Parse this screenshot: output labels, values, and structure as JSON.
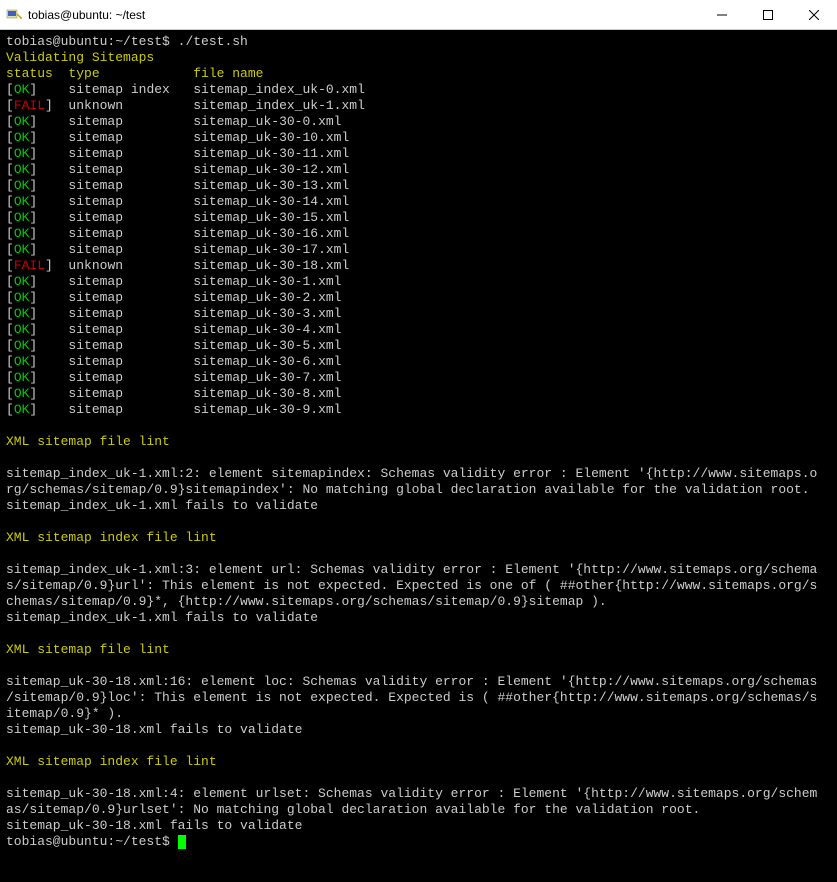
{
  "window": {
    "title": "tobias@ubuntu: ~/test"
  },
  "terminal": {
    "prompt": "tobias@ubuntu:~/test$ ",
    "command": "./test.sh",
    "heading_validating": "Validating Sitemaps",
    "header": {
      "status": "status",
      "type": "type",
      "filename": "file name"
    },
    "rows": [
      {
        "bracket_open": "[",
        "status": "OK",
        "bracket_close": "]",
        "status_class": "green",
        "type": "sitemap index",
        "file": "sitemap_index_uk-0.xml"
      },
      {
        "bracket_open": "[",
        "status": "FAIL",
        "bracket_close": "]",
        "status_class": "red",
        "type": "unknown",
        "file": "sitemap_index_uk-1.xml"
      },
      {
        "bracket_open": "[",
        "status": "OK",
        "bracket_close": "]",
        "status_class": "green",
        "type": "sitemap",
        "file": "sitemap_uk-30-0.xml"
      },
      {
        "bracket_open": "[",
        "status": "OK",
        "bracket_close": "]",
        "status_class": "green",
        "type": "sitemap",
        "file": "sitemap_uk-30-10.xml"
      },
      {
        "bracket_open": "[",
        "status": "OK",
        "bracket_close": "]",
        "status_class": "green",
        "type": "sitemap",
        "file": "sitemap_uk-30-11.xml"
      },
      {
        "bracket_open": "[",
        "status": "OK",
        "bracket_close": "]",
        "status_class": "green",
        "type": "sitemap",
        "file": "sitemap_uk-30-12.xml"
      },
      {
        "bracket_open": "[",
        "status": "OK",
        "bracket_close": "]",
        "status_class": "green",
        "type": "sitemap",
        "file": "sitemap_uk-30-13.xml"
      },
      {
        "bracket_open": "[",
        "status": "OK",
        "bracket_close": "]",
        "status_class": "green",
        "type": "sitemap",
        "file": "sitemap_uk-30-14.xml"
      },
      {
        "bracket_open": "[",
        "status": "OK",
        "bracket_close": "]",
        "status_class": "green",
        "type": "sitemap",
        "file": "sitemap_uk-30-15.xml"
      },
      {
        "bracket_open": "[",
        "status": "OK",
        "bracket_close": "]",
        "status_class": "green",
        "type": "sitemap",
        "file": "sitemap_uk-30-16.xml"
      },
      {
        "bracket_open": "[",
        "status": "OK",
        "bracket_close": "]",
        "status_class": "green",
        "type": "sitemap",
        "file": "sitemap_uk-30-17.xml"
      },
      {
        "bracket_open": "[",
        "status": "FAIL",
        "bracket_close": "]",
        "status_class": "red",
        "type": "unknown",
        "file": "sitemap_uk-30-18.xml"
      },
      {
        "bracket_open": "[",
        "status": "OK",
        "bracket_close": "]",
        "status_class": "green",
        "type": "sitemap",
        "file": "sitemap_uk-30-1.xml"
      },
      {
        "bracket_open": "[",
        "status": "OK",
        "bracket_close": "]",
        "status_class": "green",
        "type": "sitemap",
        "file": "sitemap_uk-30-2.xml"
      },
      {
        "bracket_open": "[",
        "status": "OK",
        "bracket_close": "]",
        "status_class": "green",
        "type": "sitemap",
        "file": "sitemap_uk-30-3.xml"
      },
      {
        "bracket_open": "[",
        "status": "OK",
        "bracket_close": "]",
        "status_class": "green",
        "type": "sitemap",
        "file": "sitemap_uk-30-4.xml"
      },
      {
        "bracket_open": "[",
        "status": "OK",
        "bracket_close": "]",
        "status_class": "green",
        "type": "sitemap",
        "file": "sitemap_uk-30-5.xml"
      },
      {
        "bracket_open": "[",
        "status": "OK",
        "bracket_close": "]",
        "status_class": "green",
        "type": "sitemap",
        "file": "sitemap_uk-30-6.xml"
      },
      {
        "bracket_open": "[",
        "status": "OK",
        "bracket_close": "]",
        "status_class": "green",
        "type": "sitemap",
        "file": "sitemap_uk-30-7.xml"
      },
      {
        "bracket_open": "[",
        "status": "OK",
        "bracket_close": "]",
        "status_class": "green",
        "type": "sitemap",
        "file": "sitemap_uk-30-8.xml"
      },
      {
        "bracket_open": "[",
        "status": "OK",
        "bracket_close": "]",
        "status_class": "green",
        "type": "sitemap",
        "file": "sitemap_uk-30-9.xml"
      }
    ],
    "sections": {
      "lint1": "XML sitemap file lint",
      "lint2": "XML sitemap index file lint",
      "lint3": "XML sitemap file lint",
      "lint4": "XML sitemap index file lint"
    },
    "messages": {
      "m1": "sitemap_index_uk-1.xml:2: element sitemapindex: Schemas validity error : Element '{http://www.sitemaps.org/schemas/sitemap/0.9}sitemapindex': No matching global declaration available for the validation root.",
      "m1b": "sitemap_index_uk-1.xml fails to validate",
      "m2": "sitemap_index_uk-1.xml:3: element url: Schemas validity error : Element '{http://www.sitemaps.org/schemas/sitemap/0.9}url': This element is not expected. Expected is one of ( ##other{http://www.sitemaps.org/schemas/sitemap/0.9}*, {http://www.sitemaps.org/schemas/sitemap/0.9}sitemap ).",
      "m2b": "sitemap_index_uk-1.xml fails to validate",
      "m3": "sitemap_uk-30-18.xml:16: element loc: Schemas validity error : Element '{http://www.sitemaps.org/schemas/sitemap/0.9}loc': This element is not expected. Expected is ( ##other{http://www.sitemaps.org/schemas/sitemap/0.9}* ).",
      "m3b": "sitemap_uk-30-18.xml fails to validate",
      "m4": "sitemap_uk-30-18.xml:4: element urlset: Schemas validity error : Element '{http://www.sitemaps.org/schemas/sitemap/0.9}urlset': No matching global declaration available for the validation root.",
      "m4b": "sitemap_uk-30-18.xml fails to validate"
    }
  }
}
